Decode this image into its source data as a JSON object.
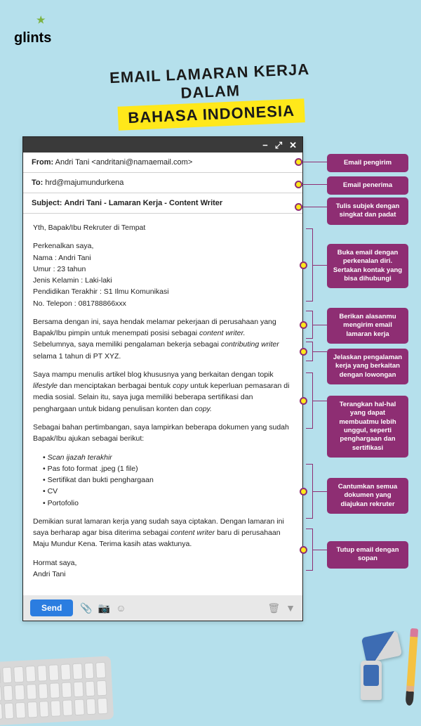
{
  "logo": "glints",
  "title": {
    "line1": "EMAIL LAMARAN KERJA DALAM",
    "line2": "BAHASA INDONESIA"
  },
  "email": {
    "from_label": "From:",
    "from_value": "Andri Tani <andritani@namaemail.com>",
    "to_label": "To:",
    "to_value": "hrd@majumundurkena",
    "subject_label": "Subject:",
    "subject_value": "Andri Tani - Lamaran Kerja - Content Writer",
    "greeting": "Yth, Bapak/Ibu Rekruter di Tempat",
    "intro": "Perkenalkan saya,",
    "ident": {
      "l1": "Nama  : Andri Tani",
      "l2": "Umur  : 23 tahun",
      "l3": "Jenis Kelamin : Laki-laki",
      "l4": "Pendidikan Terakhir  : S1 Ilmu Komunikasi",
      "l5": "No. Telepon  : 081788866xxx"
    },
    "p1a": "Bersama dengan ini, saya hendak melamar pekerjaan di perusahaan yang Bapak/Ibu pimpin untuk menempati posisi sebagai ",
    "p1em": "content writer.",
    "p1b": "Sebelumnya, saya memiliki pengalaman bekerja sebagai ",
    "p1em2": "contributing writer",
    "p1c": " selama 1 tahun di PT XYZ.",
    "p2a": "Saya mampu menulis artikel blog khususnya yang berkaitan dengan topik ",
    "p2em": "lifestyle",
    "p2b": " dan menciptakan berbagai bentuk ",
    "p2em2": "copy",
    "p2c": " untuk keperluan pemasaran di media sosial. Selain itu, saya juga memiliki beberapa sertifikasi dan penghargaan untuk bidang penulisan konten dan ",
    "p2em3": "copy.",
    "p3": "Sebagai bahan pertimbangan, saya lampirkan beberapa dokumen yang sudah Bapak/Ibu ajukan sebagai berikut:",
    "docs": {
      "d1": "Scan ijazah terakhir",
      "d2": "Pas foto format .jpeg (1 file)",
      "d3": "Sertifikat dan bukti penghargaan",
      "d4": "CV",
      "d5": "Portofolio"
    },
    "p4a": "Demikian surat lamaran kerja yang sudah saya ciptakan. Dengan lamaran ini saya berharap agar bisa diterima sebagai ",
    "p4em": "content writer",
    "p4b": " baru di perusahaan Maju Mundur Kena. Terima kasih atas waktunya.",
    "sign1": "Hormat saya,",
    "sign2": "Andri Tani",
    "send": "Send"
  },
  "annot": {
    "a1": "Email pengirim",
    "a2": "Email penerima",
    "a3": "Tulis subjek dengan singkat dan padat",
    "a4": "Buka email dengan perkenalan diri. Sertakan kontak yang bisa dihubungi",
    "a5": "Berikan alasanmu mengirim email lamaran kerja",
    "a6": "Jelaskan pengalaman kerja yang berkaitan dengan lowongan",
    "a7": "Terangkan hal-hal yang dapat membuatmu lebih unggul, seperti penghargaan dan sertifikasi",
    "a8": "Cantumkan semua dokumen yang diajukan rekruter",
    "a9": "Tutup email dengan sopan"
  }
}
